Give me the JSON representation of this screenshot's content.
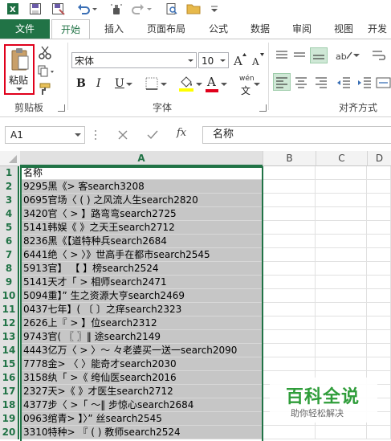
{
  "tabs": [
    "文件",
    "开始",
    "插入",
    "页面布局",
    "公式",
    "数据",
    "审阅",
    "视图",
    "开发"
  ],
  "ribbon": {
    "paste_label": "粘贴",
    "clipboard_label": "剪贴板",
    "font_name": "宋体",
    "font_size": "10",
    "font_label": "字体",
    "align_label": "对齐方式",
    "bold": "B",
    "italic": "I",
    "underline": "U",
    "font_color_letter": "A",
    "wen_label": "wén",
    "wen_char": "文"
  },
  "formula_bar": {
    "name_box": "A1",
    "fx_label": "fx",
    "content": "名称"
  },
  "columns": [
    "A",
    "B",
    "C",
    "D"
  ],
  "rows": [
    {
      "n": "1",
      "a": "名称"
    },
    {
      "n": "2",
      "a": "9295黑《>  客search3208"
    },
    {
      "n": "3",
      "a": "0695官场〈 ( ) 之风流人生search2820"
    },
    {
      "n": "4",
      "a": "3420官〈 > 】路弯弯search2725"
    },
    {
      "n": "5",
      "a": "5141韩娱《 》之天王search2712"
    },
    {
      "n": "6",
      "a": "8236黑《【道特种兵search2684"
    },
    {
      "n": "7",
      "a": "6441绝〈 > 〉》世高手在都市search2545"
    },
    {
      "n": "8",
      "a": "5913官】 【 】榜search2524"
    },
    {
      "n": "9",
      "a": "5141天才「 > 相师search2471"
    },
    {
      "n": "10",
      "a": "5094重】” 生之资源大亨search2469"
    },
    {
      "n": "11",
      "a": "0437七年】( 〔 〕之痒search2323"
    },
    {
      "n": "12",
      "a": "2626上『 > 】位search2312"
    },
    {
      "n": "13",
      "a": "9743官( 〖 〗‖ 途search2149"
    },
    {
      "n": "14",
      "a": "4443亿万〈 > 〉〜 々老婆买一送一search2090"
    },
    {
      "n": "15",
      "a": "7778金> 〈 〉能奇才search2030"
    },
    {
      "n": "16",
      "a": "3158纨「 >《 绔仙医search2016"
    },
    {
      "n": "17",
      "a": "2327天>《 》才医生search2712"
    },
    {
      "n": "18",
      "a": "4377步〈 >「 〜‖ 步惊心search2684"
    },
    {
      "n": "19",
      "a": "0963绾青> 】〉” 丝search2545"
    },
    {
      "n": "20",
      "a": "3310特种> 『 ( ) 教师search2524"
    }
  ],
  "watermark": {
    "title": "百科全说",
    "subtitle": "助你轻松解决"
  }
}
